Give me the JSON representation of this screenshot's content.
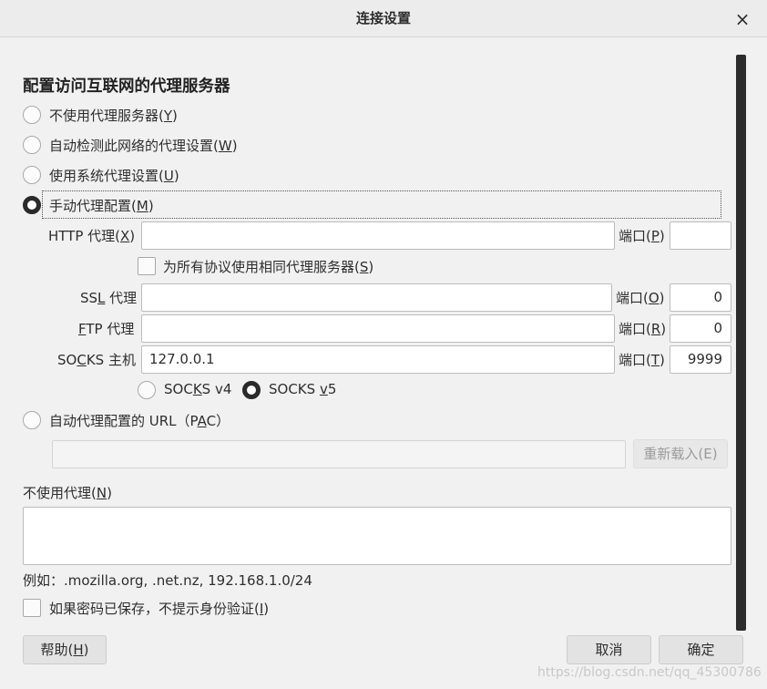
{
  "window": {
    "title": "连接设置",
    "close_icon": "×"
  },
  "heading": "配置访问互联网的代理服务器",
  "proxy_modes": [
    {
      "text": "不使用代理服务器(",
      "key": "Y",
      "tail": ")",
      "checked": false
    },
    {
      "text": "自动检测此网络的代理设置(",
      "key": "W",
      "tail": ")",
      "checked": false
    },
    {
      "text": "使用系统代理设置(",
      "key": "U",
      "tail": ")",
      "checked": false
    },
    {
      "text": "手动代理配置(",
      "key": "M",
      "tail": ")",
      "checked": true
    }
  ],
  "http": {
    "label_pre": "HTTP 代理(",
    "label_key": "X",
    "label_post": ")",
    "value": "",
    "port_pre": "端口(",
    "port_key": "P",
    "port_post": ")",
    "port": ""
  },
  "same_proxy": {
    "text": "为所有协议使用相同代理服务器(",
    "key": "S",
    "tail": ")",
    "checked": false
  },
  "ssl": {
    "label_pre": "SS",
    "label_key": "L",
    "label_post": " 代理",
    "value": "",
    "port_pre": "端口(",
    "port_key": "O",
    "port_post": ")",
    "port": "0"
  },
  "ftp": {
    "label_pre": "",
    "label_key": "F",
    "label_post": "TP 代理",
    "value": "",
    "port_pre": "端口(",
    "port_key": "R",
    "port_post": ")",
    "port": "0"
  },
  "socks": {
    "label_pre": "SO",
    "label_key": "C",
    "label_post": "KS 主机",
    "value": "127.0.0.1",
    "port_pre": "端口(",
    "port_key": "T",
    "port_post": ")",
    "port": "9999"
  },
  "socks_version": {
    "v4_pre": "SOC",
    "v4_key": "K",
    "v4_post": "S v4",
    "v4_checked": false,
    "v5_pre": "SOCKS ",
    "v5_key": "v",
    "v5_post": "5",
    "v5_checked": true
  },
  "pac": {
    "text_pre": "自动代理配置的 URL（P",
    "text_key": "A",
    "text_post": "C）",
    "checked": false,
    "value": "",
    "reload_label": "重新载入(E)"
  },
  "no_proxy": {
    "label_pre": "不使用代理(",
    "label_key": "N",
    "label_post": ")",
    "value": "",
    "example": "例如：.mozilla.org, .net.nz, 192.168.1.0/24"
  },
  "no_auth_prompt": {
    "text": "如果密码已保存，不提示身份验证(",
    "key": "I",
    "tail": ")",
    "checked": false
  },
  "buttons": {
    "help_pre": "帮助(",
    "help_key": "H",
    "help_post": ")",
    "cancel": "取消",
    "ok": "确定"
  },
  "watermark": "https://blog.csdn.net/qq_45300786"
}
